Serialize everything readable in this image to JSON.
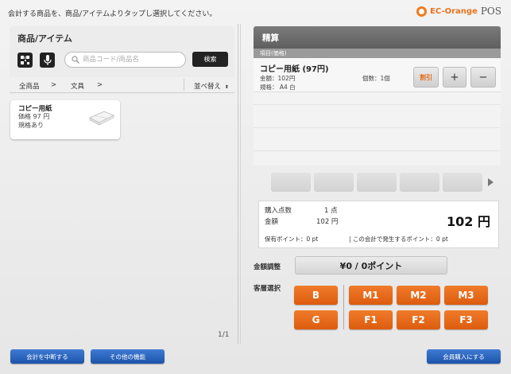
{
  "header": {
    "instruction": "会計する商品を、商品/アイテムよりタップし選択してください。",
    "brand_name": "EC-Orange",
    "brand_suffix": "POS"
  },
  "left": {
    "title": "商品/アイテム",
    "search_placeholder": "商品コード/商品名",
    "search_button": "検索",
    "breadcrumb": [
      "全商品",
      ">",
      "文具",
      ">"
    ],
    "sort_label": "並べ替え",
    "products": [
      {
        "name": "コピー用紙",
        "price": "価格 97 円",
        "stock": "規格あり"
      }
    ],
    "pagination": "1/1"
  },
  "right": {
    "title": "精算",
    "list_header": "項目(価格)",
    "cart": [
      {
        "name": "コピー用紙 (97円)",
        "amount": "金額：102円",
        "spec": "規格：  A4 白",
        "qty": "個数：1個"
      }
    ],
    "discount_label": "割引",
    "plus_label": "+",
    "minus_label": "−",
    "totals": {
      "count_label": "購入点数",
      "count_value": "1 点",
      "amount_label": "金額",
      "amount_value": "102 円",
      "total": "102 円",
      "points_held": "保有ポイント：0 pt",
      "points_earned": "| この会計で発生するポイント：0 pt"
    },
    "adjust_label": "金額調整",
    "adjust_value": "¥0 / 0ポイント",
    "segment_label": "客層選択",
    "segments": [
      "B",
      "M1",
      "M2",
      "M3",
      "G",
      "F1",
      "F2",
      "F3"
    ]
  },
  "footer": {
    "cancel_label": "会計を中断する",
    "other_label": "その他の機能",
    "member_label": "会員購入にする"
  },
  "colors": {
    "accent_orange": "#e8731e",
    "button_blue": "#2a63bd",
    "header_gray": "#6c6c6c"
  }
}
